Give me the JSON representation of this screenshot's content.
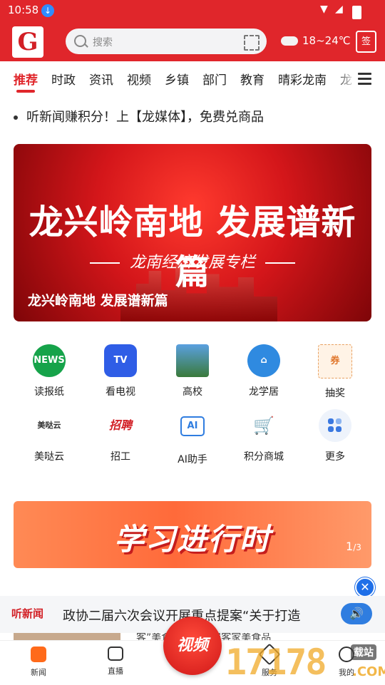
{
  "status": {
    "time": "10:58"
  },
  "header": {
    "search_placeholder": "搜索",
    "weather": "18~24℃",
    "checkin_label": "签",
    "logo_text": "G"
  },
  "tabs": [
    "推荐",
    "时政",
    "资讯",
    "视频",
    "乡镇",
    "部门",
    "教育",
    "晴彩龙南",
    "龙"
  ],
  "ticker": "听新闻赚积分！上【龙媒体】，免费兑商品",
  "banner": {
    "headline": "龙兴岭南地 发展谱新篇",
    "subtitle": "龙南经济发展专栏",
    "caption": "龙兴岭南地 发展谱新篇",
    "active_index": 0,
    "count": 5
  },
  "grid": [
    {
      "label": "读报纸",
      "icon": "newspaper-icon",
      "glyph": "NEWS"
    },
    {
      "label": "看电视",
      "icon": "tv-icon",
      "glyph": "TV"
    },
    {
      "label": "高校",
      "icon": "university-icon",
      "glyph": ""
    },
    {
      "label": "龙学居",
      "icon": "house-icon",
      "glyph": "⌂"
    },
    {
      "label": "抽奖",
      "icon": "lottery-ticket-icon",
      "glyph": "券"
    },
    {
      "label": "美哒云",
      "icon": "meida-cloud-icon",
      "glyph": "美哒云"
    },
    {
      "label": "招工",
      "icon": "recruit-icon",
      "glyph": "招聘"
    },
    {
      "label": "AI助手",
      "icon": "ai-assistant-icon",
      "glyph": "AI"
    },
    {
      "label": "积分商城",
      "icon": "shopping-cart-icon",
      "glyph": "🛒"
    },
    {
      "label": "更多",
      "icon": "more-apps-icon",
      "glyph": ""
    }
  ],
  "promo": {
    "title": "学习进行时",
    "page": "1",
    "total": "/3"
  },
  "audio": {
    "badge": "听新闻",
    "text": "政协二届六次会议开展重点提案“关于打造",
    "peek_text": "客”美食品牌南围屋客家美食品"
  },
  "bottom_nav": [
    {
      "label": "新闻",
      "icon": "news-tab-icon"
    },
    {
      "label": "直播",
      "icon": "live-tab-icon"
    },
    {
      "label": "视频",
      "icon": "video-tab-icon"
    },
    {
      "label": "服务",
      "icon": "service-tab-icon"
    },
    {
      "label": "我的",
      "icon": "profile-tab-icon"
    }
  ],
  "watermark": {
    "number": "17178",
    "tag": "载站",
    "domain": ".COM"
  },
  "colors": {
    "brand_red": "#e0262b",
    "accent_blue": "#2f7de0",
    "promo_orange": "#ff6a3a"
  }
}
